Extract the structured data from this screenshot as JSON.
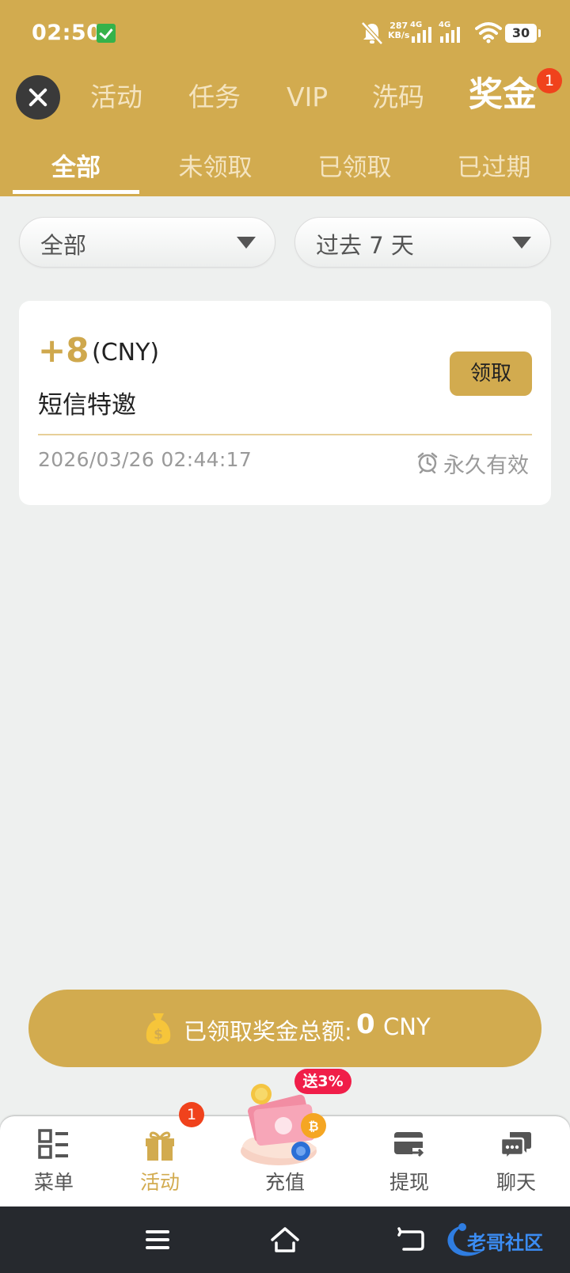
{
  "status_bar": {
    "time": "02:50",
    "net_speed_value": "287",
    "net_speed_unit": "KB/s",
    "sim1_label": "4G",
    "sim2_label": "4G",
    "battery": "30"
  },
  "top_tabs": [
    {
      "label": "活动"
    },
    {
      "label": "任务"
    },
    {
      "label": "VIP"
    },
    {
      "label": "洗码"
    },
    {
      "label": "奖金",
      "badge": "1"
    }
  ],
  "sub_tabs": [
    {
      "label": "全部"
    },
    {
      "label": "未领取"
    },
    {
      "label": "已领取"
    },
    {
      "label": "已过期"
    }
  ],
  "filters": {
    "type_selected": "全部",
    "range_selected": "过去 7 天"
  },
  "bonus_card": {
    "amount": "+8",
    "currency": "(CNY)",
    "title": "短信特邀",
    "claim_label": "领取",
    "datetime": "2026/03/26 02:44:17",
    "validity": "永久有效"
  },
  "total_bar": {
    "label": "已领取奖金总额:",
    "value": "0",
    "currency": "CNY"
  },
  "bottom_nav": {
    "menu": "菜单",
    "activity": "活动",
    "activity_badge": "1",
    "recharge": "充值",
    "recharge_promo": "送3%",
    "withdraw": "提现",
    "chat": "聊天"
  },
  "colors": {
    "brand_gold": "#d2ab4f",
    "badge_red": "#f0421c",
    "promo_red": "#f01e49",
    "page_bg": "#eef0ef"
  },
  "watermark": "老哥社区"
}
